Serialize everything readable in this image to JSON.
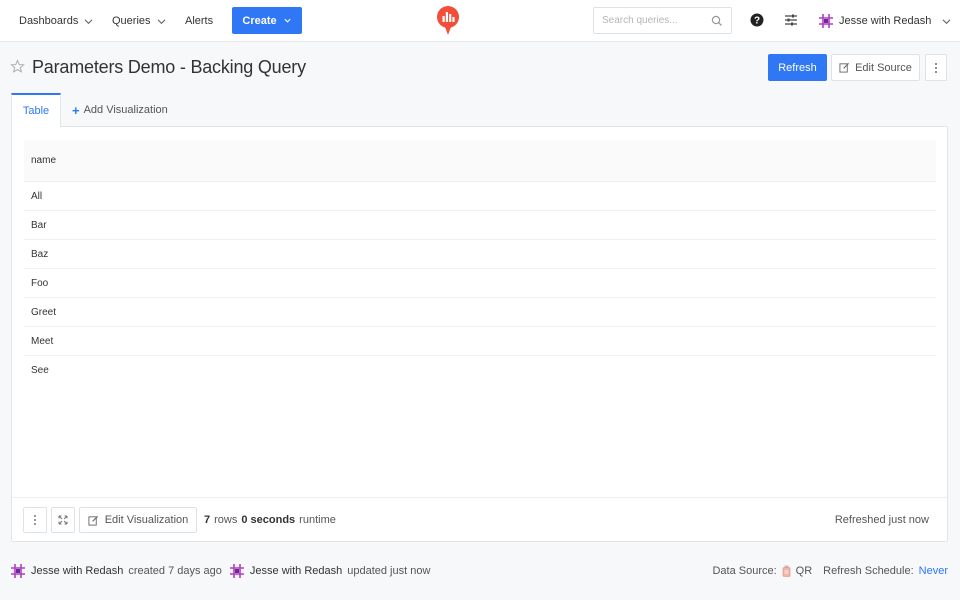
{
  "nav": {
    "dashboards": "Dashboards",
    "queries": "Queries",
    "alerts": "Alerts",
    "create": "Create",
    "search_placeholder": "Search queries...",
    "user_name": "Jesse with Redash",
    "accent_color": "#2f77f5",
    "logo_color": "#f44e3b"
  },
  "header": {
    "title": "Parameters Demo - Backing Query",
    "refresh": "Refresh",
    "edit_source": "Edit Source"
  },
  "tabs": {
    "table": "Table",
    "add_visualization": "Add Visualization"
  },
  "table": {
    "column": "name",
    "rows": [
      "All",
      "Bar",
      "Baz",
      "Foo",
      "Greet",
      "Meet",
      "See"
    ]
  },
  "footer": {
    "edit_visualization": "Edit Visualization",
    "row_count": "7",
    "rows_label": "rows",
    "runtime": "0 seconds",
    "runtime_label": "runtime",
    "refreshed": "Refreshed just now"
  },
  "meta": {
    "created_by": "Jesse with Redash",
    "created_text": "created 7 days ago",
    "updated_by": "Jesse with Redash",
    "updated_text": "updated just now",
    "data_source_label": "Data Source:",
    "data_source": "QR",
    "schedule_label": "Refresh Schedule:",
    "schedule": "Never"
  }
}
